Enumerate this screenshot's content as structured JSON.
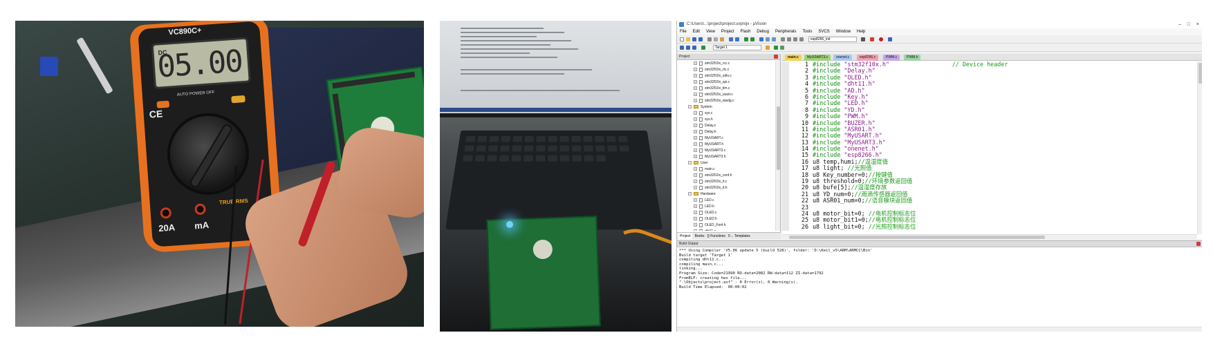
{
  "photo_multimeter": {
    "meter_brand": "VC890C+",
    "display_mode": "DC",
    "display_value": "05.00",
    "ce_mark": "CE",
    "range_label": "20A",
    "unit_label": "mA",
    "true_rms": "TRUE RMS",
    "power_label": "AUTO POWER OFF"
  },
  "ide": {
    "title": "C:\\Users\\...\\project\\project.uvprojx - µVision",
    "window_controls": [
      "–",
      "□",
      "×"
    ],
    "menu": [
      "File",
      "Edit",
      "View",
      "Project",
      "Flash",
      "Debug",
      "Peripherals",
      "Tools",
      "SVCS",
      "Window",
      "Help"
    ],
    "target_select": "Target 1",
    "find_select": "esp8266_init",
    "project_pane_title": "Project",
    "project_tree": [
      {
        "kind": "file",
        "level": 2,
        "name": "stm32f10x_rcc.c"
      },
      {
        "kind": "file",
        "level": 2,
        "name": "stm32f10x_rtc.c"
      },
      {
        "kind": "file",
        "level": 2,
        "name": "stm32f10x_sdio.c"
      },
      {
        "kind": "file",
        "level": 2,
        "name": "stm32f10x_spi.c"
      },
      {
        "kind": "file",
        "level": 2,
        "name": "stm32f10x_tim.c"
      },
      {
        "kind": "file",
        "level": 2,
        "name": "stm32f10x_usart.c"
      },
      {
        "kind": "file",
        "level": 2,
        "name": "stm32f10x_wwdg.c"
      },
      {
        "kind": "folder",
        "level": 1,
        "name": "System"
      },
      {
        "kind": "file",
        "level": 2,
        "name": "sys.c"
      },
      {
        "kind": "file",
        "level": 2,
        "name": "sys.h"
      },
      {
        "kind": "file",
        "level": 2,
        "name": "Delay.c"
      },
      {
        "kind": "file",
        "level": 2,
        "name": "Delay.h"
      },
      {
        "kind": "file",
        "level": 2,
        "name": "MyUSART.c"
      },
      {
        "kind": "file",
        "level": 2,
        "name": "MyUSART.h"
      },
      {
        "kind": "file",
        "level": 2,
        "name": "MyUSART3.c"
      },
      {
        "kind": "file",
        "level": 2,
        "name": "MyUSART3.h"
      },
      {
        "kind": "folder",
        "level": 1,
        "name": "User"
      },
      {
        "kind": "file",
        "level": 2,
        "name": "main.c"
      },
      {
        "kind": "file",
        "level": 2,
        "name": "stm32f10x_conf.h"
      },
      {
        "kind": "file",
        "level": 2,
        "name": "stm32f10x_it.c"
      },
      {
        "kind": "file",
        "level": 2,
        "name": "stm32f10x_it.h"
      },
      {
        "kind": "folder",
        "level": 1,
        "name": "Hardware"
      },
      {
        "kind": "file",
        "level": 2,
        "name": "LED.c"
      },
      {
        "kind": "file",
        "level": 2,
        "name": "LED.h"
      },
      {
        "kind": "file",
        "level": 2,
        "name": "OLED.c"
      },
      {
        "kind": "file",
        "level": 2,
        "name": "OLED.h"
      },
      {
        "kind": "file",
        "level": 2,
        "name": "OLED_Font.h"
      },
      {
        "kind": "file",
        "level": 2,
        "name": "dht11.c"
      }
    ],
    "project_tabs": [
      "Project",
      "Books",
      "{} Functions",
      "0→ Templates"
    ],
    "file_tabs": [
      {
        "label": "main.c",
        "color": "#f4d25a"
      },
      {
        "label": "MyUSART3.c",
        "color": "#9fd27a"
      },
      {
        "label": "onenet.c",
        "color": "#a8c8f0"
      },
      {
        "label": "esp8266.c",
        "color": "#f0a0b4"
      },
      {
        "label": "PWM.c",
        "color": "#c4a8e8"
      },
      {
        "label": "PWM.h",
        "color": "#9fd2a8"
      }
    ],
    "code_lines": [
      {
        "n": "1",
        "kind": "inc",
        "dir": "#include ",
        "str": "\"stm32f10x.h\"",
        "cmt": "                  // Device header"
      },
      {
        "n": "2",
        "kind": "inc",
        "dir": "#include ",
        "str": "\"Delay.h\"",
        "cmt": ""
      },
      {
        "n": "3",
        "kind": "inc",
        "dir": "#include ",
        "str": "\"OLED.h\"",
        "cmt": ""
      },
      {
        "n": "4",
        "kind": "inc",
        "dir": "#include ",
        "str": "\"dht11.h\"",
        "cmt": ""
      },
      {
        "n": "5",
        "kind": "inc",
        "dir": "#include ",
        "str": "\"AD.h\"",
        "cmt": ""
      },
      {
        "n": "6",
        "kind": "inc",
        "dir": "#include ",
        "str": "\"Key.h\"",
        "cmt": ""
      },
      {
        "n": "7",
        "kind": "inc",
        "dir": "#include ",
        "str": "\"LED.h\"",
        "cmt": ""
      },
      {
        "n": "8",
        "kind": "inc",
        "dir": "#include ",
        "str": "\"YD.h\"",
        "cmt": ""
      },
      {
        "n": "9",
        "kind": "inc",
        "dir": "#include ",
        "str": "\"PWM.h\"",
        "cmt": ""
      },
      {
        "n": "10",
        "kind": "inc",
        "dir": "#include ",
        "str": "\"BUZER.h\"",
        "cmt": ""
      },
      {
        "n": "11",
        "kind": "inc",
        "dir": "#include ",
        "str": "\"ASR01.h\"",
        "cmt": ""
      },
      {
        "n": "12",
        "kind": "inc",
        "dir": "#include ",
        "str": "\"MyUSART.h\"",
        "cmt": ""
      },
      {
        "n": "13",
        "kind": "inc",
        "dir": "#include ",
        "str": "\"MyUSART3.h\"",
        "cmt": ""
      },
      {
        "n": "14",
        "kind": "inc",
        "dir": "#include ",
        "str": "\"onenet.h\"",
        "cmt": ""
      },
      {
        "n": "15",
        "kind": "inc",
        "dir": "#include ",
        "str": "\"esp8266.h\"",
        "cmt": ""
      },
      {
        "n": "16",
        "kind": "code",
        "code": "u8 temp,humi;",
        "cmt": "//温湿度值"
      },
      {
        "n": "17",
        "kind": "code",
        "code": "u8 light; ",
        "cmt": "//光照值"
      },
      {
        "n": "18",
        "kind": "code",
        "code": "u8 Key_number=0;",
        "cmt": "//按键值"
      },
      {
        "n": "19",
        "kind": "code",
        "code": "u8 threshold=0;",
        "cmt": "//环境参数返回值"
      },
      {
        "n": "20",
        "kind": "code",
        "code": "u8 bufe[5];",
        "cmt": "//温湿度存放"
      },
      {
        "n": "21",
        "kind": "code",
        "code": "u8 YD_num=0;",
        "cmt": "//雨滴传感器返回值"
      },
      {
        "n": "22",
        "kind": "code",
        "code": "u8 ASR01_num=0;",
        "cmt": "//语音模块返回值"
      },
      {
        "n": "23",
        "kind": "code",
        "code": "",
        "cmt": ""
      },
      {
        "n": "24",
        "kind": "code",
        "code": "u8 motor_bit=0; ",
        "cmt": "//电机控制标志位"
      },
      {
        "n": "25",
        "kind": "code",
        "code": "u8 motor_bit1=0;",
        "cmt": "//电机控制标志位"
      },
      {
        "n": "26",
        "kind": "code",
        "code": "u8 light_bit=0; ",
        "cmt": "//光照控制标志位"
      }
    ],
    "build_title": "Build Output",
    "build_lines": [
      "*** Using Compiler 'V5.06 update 5 (build 528)', folder: 'D:\\Keil_v5\\ARM\\ARMCC\\Bin'",
      "Build target 'Target 1'",
      "compiling dht11.c...",
      "compiling main.c...",
      "linking...",
      "Program Size: Code=21990 RO-data=2082 RW-data=112 ZI-data=1792",
      "FromELF: creating hex file...",
      "\".\\Objects\\project.axf\" - 0 Error(s), 0 Warning(s).",
      "Build Time Elapsed:  00:00:02"
    ]
  }
}
